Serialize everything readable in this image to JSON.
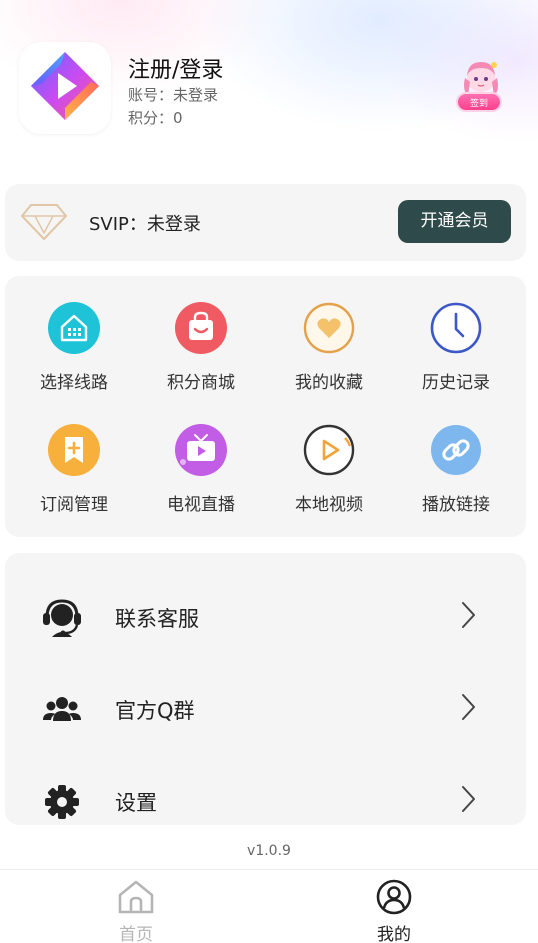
{
  "header": {
    "title": "注册/登录",
    "account_line": "账号：未登录",
    "points_line": "积分：0",
    "signin_label": "签到"
  },
  "svip": {
    "status_label": "SVIP：未登录",
    "button_label": "开通会员"
  },
  "features": [
    {
      "label": "选择线路",
      "icon": "select-route-icon",
      "color": "#1ec3d8"
    },
    {
      "label": "积分商城",
      "icon": "points-mall-icon",
      "color": "#f05a62"
    },
    {
      "label": "我的收藏",
      "icon": "favorites-icon",
      "color": "#e4a14a"
    },
    {
      "label": "历史记录",
      "icon": "history-icon",
      "color": "#3c57c8"
    },
    {
      "label": "订阅管理",
      "icon": "subscription-icon",
      "color": "#f7b03c"
    },
    {
      "label": "电视直播",
      "icon": "tv-live-icon",
      "color": "#c25ee6"
    },
    {
      "label": "本地视频",
      "icon": "local-video-icon",
      "color": "#f2a33a"
    },
    {
      "label": "播放链接",
      "icon": "play-link-icon",
      "color": "#4c9de6"
    }
  ],
  "menu": [
    {
      "label": "联系客服",
      "icon": "customer-service-icon"
    },
    {
      "label": "官方Q群",
      "icon": "group-icon"
    },
    {
      "label": "设置",
      "icon": "settings-icon"
    }
  ],
  "version": "v1.0.9",
  "nav": {
    "home_label": "首页",
    "mine_label": "我的"
  },
  "colors": {
    "vip_button_bg": "#2e4a4a",
    "card_bg": "#f5f5f5",
    "nav_inactive": "#b5b5b5",
    "nav_active": "#222222"
  }
}
